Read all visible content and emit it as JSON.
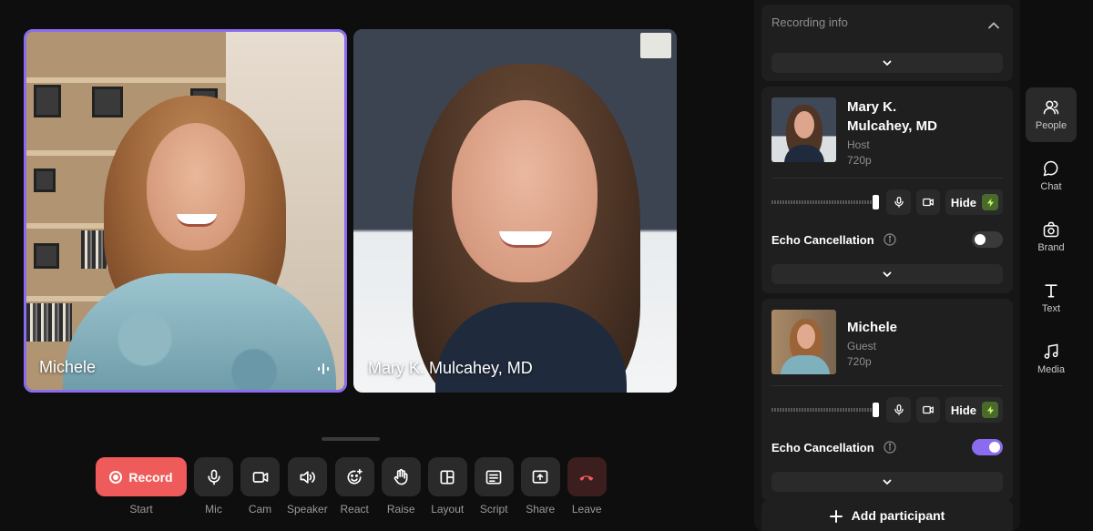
{
  "videos": [
    {
      "name": "Michele"
    },
    {
      "name": "Mary K. Mulcahey, MD"
    }
  ],
  "toolbar": {
    "record_label": "Record",
    "start_label": "Start",
    "mic_label": "Mic",
    "cam_label": "Cam",
    "speaker_label": "Speaker",
    "react_label": "React",
    "raise_label": "Raise",
    "layout_label": "Layout",
    "script_label": "Script",
    "share_label": "Share",
    "leave_label": "Leave"
  },
  "panel": {
    "recording_info_title": "Recording info",
    "participants": [
      {
        "name_line1": "Mary K.",
        "name_line2": "Mulcahey, MD",
        "role": "Host",
        "resolution": "720p",
        "hide_label": "Hide",
        "echo_label": "Echo Cancellation",
        "echo_enabled": false
      },
      {
        "name_line1": "Michele",
        "name_line2": "",
        "role": "Guest",
        "resolution": "720p",
        "hide_label": "Hide",
        "echo_label": "Echo Cancellation",
        "echo_enabled": true
      }
    ],
    "add_participant_label": "Add participant"
  },
  "rail": {
    "people": "People",
    "chat": "Chat",
    "brand": "Brand",
    "text": "Text",
    "media": "Media"
  },
  "colors": {
    "accent": "#8b6cf0",
    "record": "#ef5b5b",
    "leave_icon": "#ef5b5b"
  }
}
